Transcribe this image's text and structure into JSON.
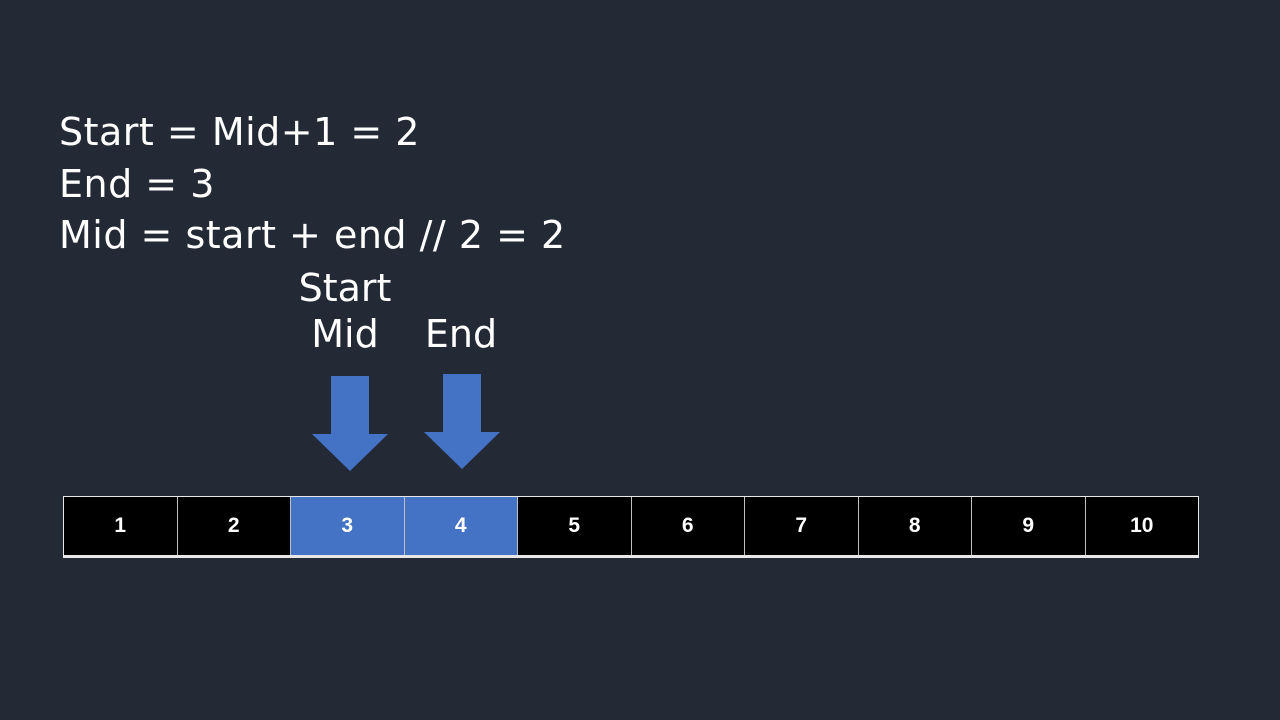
{
  "code_lines": {
    "line1": "Start = Mid+1 = 2",
    "line2": "End = 3",
    "line3": "Mid = start + end // 2 = 2"
  },
  "pointers": {
    "start_label": "Start",
    "mid_label": "Mid",
    "end_label": "End"
  },
  "array": {
    "cells": [
      "1",
      "2",
      "3",
      "4",
      "5",
      "6",
      "7",
      "8",
      "9",
      "10"
    ],
    "highlighted_indices": [
      2,
      3
    ]
  },
  "colors": {
    "background": "#232935",
    "highlight": "#4472c4",
    "cell": "#000000",
    "text": "#ffffff"
  }
}
